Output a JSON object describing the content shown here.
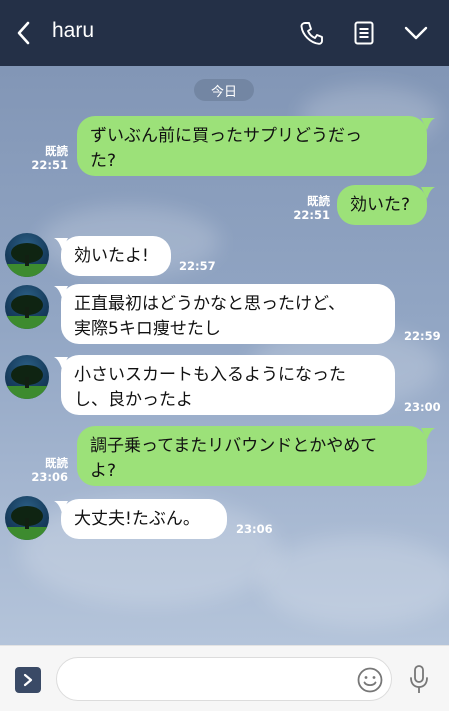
{
  "header": {
    "title": "haru"
  },
  "chat": {
    "date_label": "今日",
    "messages": [
      {
        "side": "me",
        "lines": [
          "ずいぶん前に買ったサプリどうだっ",
          "た?"
        ],
        "read": "既読",
        "time": "22:51"
      },
      {
        "side": "me",
        "lines": [
          "効いた?"
        ],
        "read": "既読",
        "time": "22:51"
      },
      {
        "side": "them",
        "lines": [
          "効いたよ!"
        ],
        "time": "22:57"
      },
      {
        "side": "them",
        "lines": [
          "正直最初はどうかなと思ったけど、",
          "実際5キロ痩せたし"
        ],
        "time": "22:59"
      },
      {
        "side": "them",
        "lines": [
          "小さいスカートも入るようになった",
          "し、良かったよ"
        ],
        "time": "23:00"
      },
      {
        "side": "me",
        "lines": [
          "調子乗ってまたリバウンドとかやめて",
          "よ?"
        ],
        "read": "既読",
        "time": "23:06"
      },
      {
        "side": "them",
        "lines": [
          "大丈夫!たぶん。"
        ],
        "time": "23:06"
      }
    ]
  },
  "input": {
    "placeholder": "",
    "value": ""
  },
  "colors": {
    "header_bg": "#243047",
    "my_bubble": "#9ce179",
    "their_bubble": "#ffffff"
  },
  "icons": [
    "back-arrow-icon",
    "phone-icon",
    "notes-icon",
    "chevron-down-icon",
    "expand-arrow-icon",
    "emoji-icon",
    "mic-icon"
  ]
}
